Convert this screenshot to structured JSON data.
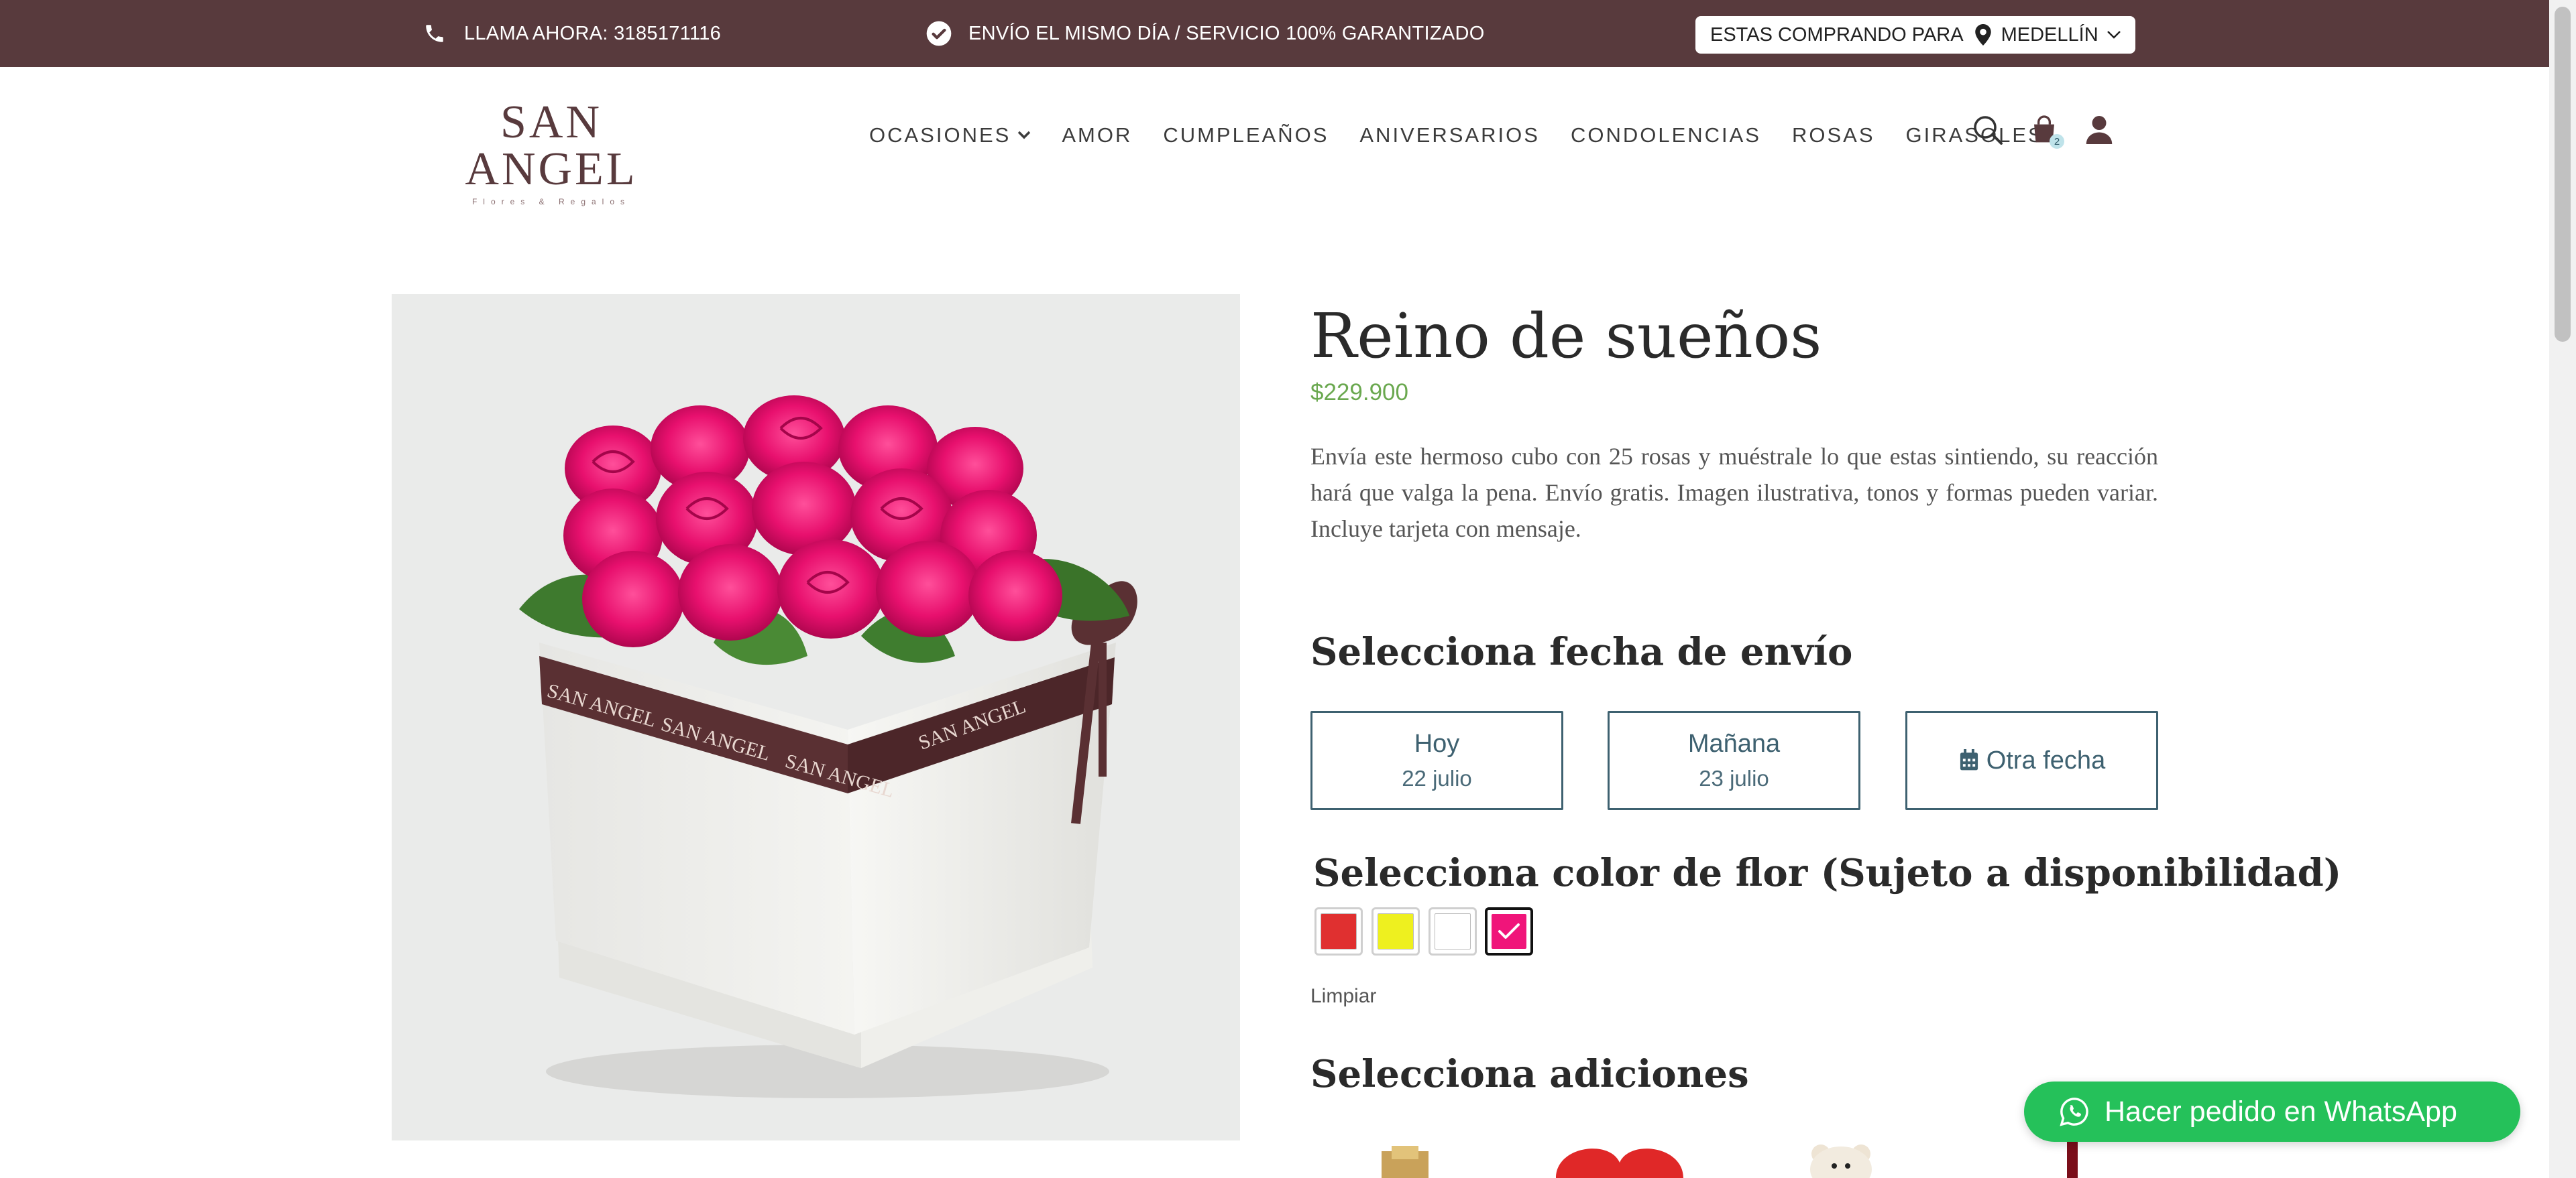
{
  "topbar": {
    "phone_text": "LLAMA AHORA: 3185171116",
    "shipping_text": "ENVÍO EL MISMO DÍA / SERVICIO 100% GARANTIZADO",
    "location_prefix": "ESTAS COMPRANDO PARA",
    "location_city": "MEDELLÍN",
    "icons": [
      "phone-icon",
      "check-circle-icon",
      "map-pin-icon",
      "chevron-down-icon"
    ]
  },
  "header": {
    "logo_text": "SAN ANGEL",
    "logo_sub": "Flores & Regalos",
    "nav": [
      {
        "label": "OCASIONES",
        "has_dropdown": true
      },
      {
        "label": "AMOR"
      },
      {
        "label": "CUMPLEAÑOS"
      },
      {
        "label": "ANIVERSARIOS"
      },
      {
        "label": "CONDOLENCIAS"
      },
      {
        "label": "ROSAS"
      },
      {
        "label": "GIRASOLES"
      }
    ],
    "cart_count": "2",
    "icons": [
      "search-icon",
      "shopping-bag-icon",
      "user-icon"
    ]
  },
  "product": {
    "title": "Reino de sueños",
    "price": "$229.900",
    "description": "Envía este hermoso cubo con 25 rosas y muéstrale lo que estas sintiendo, su reacción hará que valga la pena. Envío gratis. Imagen ilustrativa, tonos y formas pueden variar. Incluye tarjeta con mensaje.",
    "ribbon_text": "SAN ANGEL"
  },
  "delivery": {
    "title": "Selecciona fecha de envío",
    "options": [
      {
        "label": "Hoy",
        "date": "22 julio"
      },
      {
        "label": "Mañana",
        "date": "23 julio"
      },
      {
        "label": "Otra fecha",
        "icon": "calendar-icon"
      }
    ]
  },
  "color_selector": {
    "title": "Selecciona color de flor (Sujeto a disponibilidad)",
    "swatches": [
      {
        "color": "#e03030",
        "selected": false
      },
      {
        "color": "#eef01f",
        "selected": false
      },
      {
        "color": "#ffffff",
        "selected": false
      },
      {
        "color": "#f0157a",
        "selected": true
      }
    ],
    "clear_label": "Limpiar"
  },
  "addons": {
    "title": "Selecciona adiciones"
  },
  "whatsapp": {
    "label": "Hacer pedido en WhatsApp",
    "icon": "whatsapp-icon"
  },
  "colors": {
    "topbar_bg": "#583a3d",
    "price": "#6aa84f",
    "date_border": "#3e6170",
    "whatsapp_bg": "#25c15a"
  }
}
